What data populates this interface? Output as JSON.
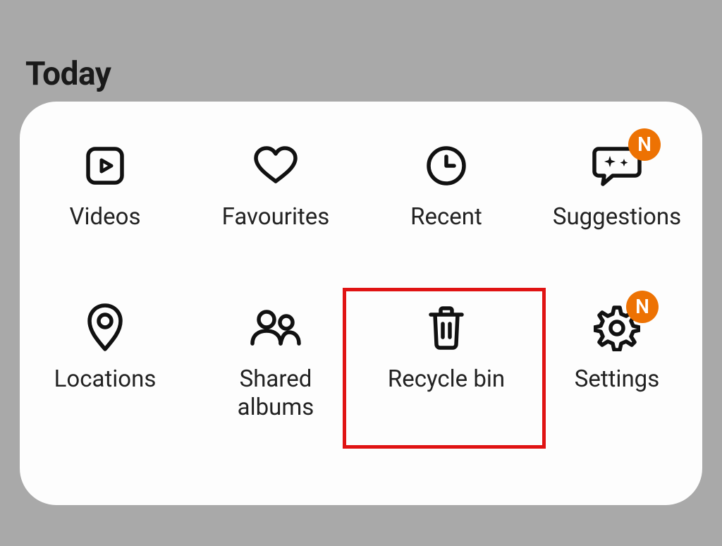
{
  "header": {
    "title": "Today"
  },
  "badge_text": "N",
  "colors": {
    "badge": "#ed7203",
    "highlight": "#e01313"
  },
  "grid": {
    "items": [
      {
        "label": "Videos",
        "icon": "videos-icon",
        "badge": false
      },
      {
        "label": "Favourites",
        "icon": "heart-icon",
        "badge": false
      },
      {
        "label": "Recent",
        "icon": "clock-icon",
        "badge": false
      },
      {
        "label": "Suggestions",
        "icon": "suggestions-icon",
        "badge": true
      },
      {
        "label": "Locations",
        "icon": "location-icon",
        "badge": false
      },
      {
        "label": "Shared albums",
        "icon": "people-icon",
        "badge": false
      },
      {
        "label": "Recycle bin",
        "icon": "trash-icon",
        "badge": false,
        "highlighted": true
      },
      {
        "label": "Settings",
        "icon": "gear-icon",
        "badge": true
      }
    ]
  }
}
